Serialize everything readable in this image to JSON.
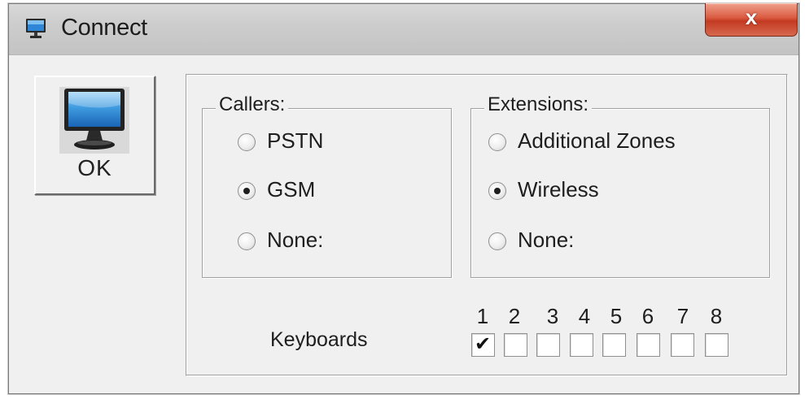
{
  "window": {
    "title": "Connect",
    "title_icon": "monitor-icon",
    "close_icon": "close-icon",
    "close_label": "x",
    "close_color": "#c43a22"
  },
  "ok_button": {
    "label": "OK",
    "icon": "monitor-icon"
  },
  "callers": {
    "title": "Callers:",
    "options": [
      {
        "label": "PSTN",
        "selected": false
      },
      {
        "label": "GSM",
        "selected": true
      },
      {
        "label": "None:",
        "selected": false
      }
    ]
  },
  "extensions": {
    "title": "Extensions:",
    "options": [
      {
        "label": "Additional Zones",
        "selected": false
      },
      {
        "label": "Wireless",
        "selected": true
      },
      {
        "label": "None:",
        "selected": false
      }
    ]
  },
  "keyboards": {
    "label": "Keyboards",
    "items": [
      {
        "number": "1",
        "checked": true
      },
      {
        "number": "2",
        "checked": false
      },
      {
        "number": "3",
        "checked": false
      },
      {
        "number": "4",
        "checked": false
      },
      {
        "number": "5",
        "checked": false
      },
      {
        "number": "6",
        "checked": false
      },
      {
        "number": "7",
        "checked": false
      },
      {
        "number": "8",
        "checked": false
      }
    ]
  }
}
